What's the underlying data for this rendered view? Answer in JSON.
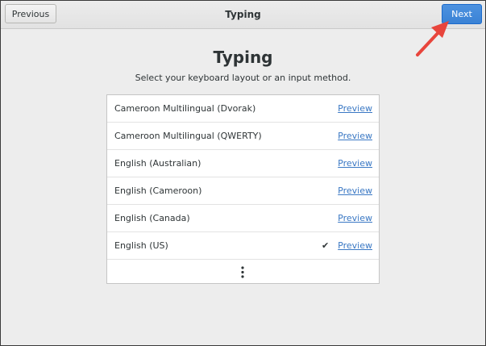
{
  "header": {
    "title": "Typing",
    "previous_label": "Previous",
    "next_label": "Next"
  },
  "page": {
    "title": "Typing",
    "subtitle": "Select your keyboard layout or an input method."
  },
  "layouts": [
    {
      "label": "Cameroon Multilingual (Dvorak)",
      "preview": "Preview",
      "selected": false
    },
    {
      "label": "Cameroon Multilingual (QWERTY)",
      "preview": "Preview",
      "selected": false
    },
    {
      "label": "English (Australian)",
      "preview": "Preview",
      "selected": false
    },
    {
      "label": "English (Cameroon)",
      "preview": "Preview",
      "selected": false
    },
    {
      "label": "English (Canada)",
      "preview": "Preview",
      "selected": false
    },
    {
      "label": "English (US)",
      "preview": "Preview",
      "selected": true
    }
  ],
  "check_glyph": "✔",
  "icons": {
    "more": "more-vertical-icon",
    "check": "checkmark-icon",
    "annotation": "annotation-arrow-icon"
  },
  "colors": {
    "accent": "#3a82d5",
    "link": "#3a78c4",
    "annotation_arrow": "#e8453c",
    "background": "#ededed"
  }
}
